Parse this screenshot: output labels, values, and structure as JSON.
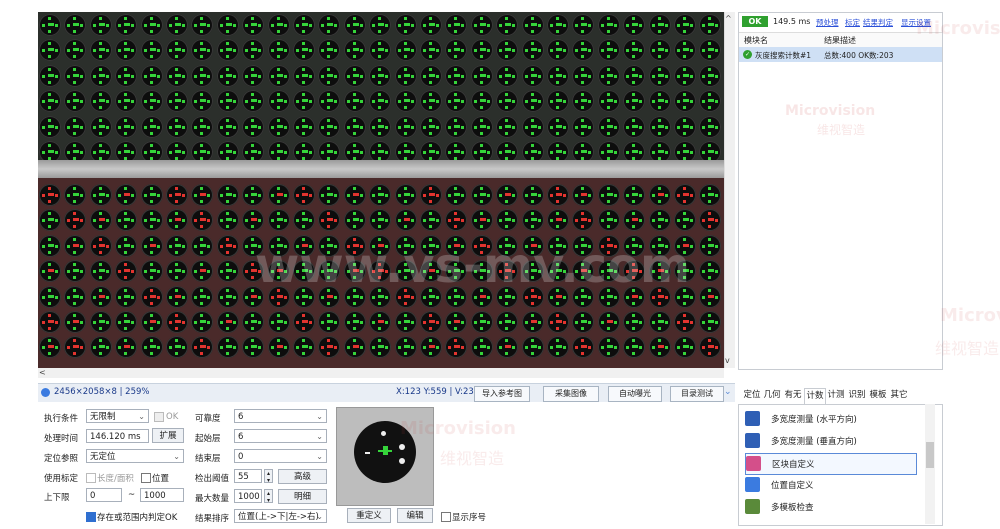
{
  "viewer": {
    "info": "2456×2058×8 | 259%",
    "coords": "X:123 Y:559 | V:23",
    "buttons": {
      "import_ref": "导入参考图",
      "capture": "采集图像",
      "auto_exposure": "自动曝光",
      "test": "目录测试"
    }
  },
  "params": {
    "exec_cond": {
      "label": "执行条件",
      "value": "无限制",
      "ok_label": "OK"
    },
    "proc_time": {
      "label": "处理时间",
      "value": "146.120 ms",
      "expand": "扩展"
    },
    "locate_ref": {
      "label": "定位参照",
      "value": "无定位"
    },
    "calib": {
      "label": "使用标定",
      "opt1": "长度/面积",
      "opt2": "位置"
    },
    "limits": {
      "label": "上下限",
      "low": "0",
      "tilde": "~",
      "high": "1000"
    },
    "in_range_ok": "存在或范围内判定OK",
    "tolerance": {
      "label": "可靠度",
      "value": "6"
    },
    "start_layer": {
      "label": "起始层",
      "value": "6"
    },
    "end_layer": {
      "label": "结束层",
      "value": "0"
    },
    "threshold": {
      "label": "检出阈值",
      "value": "55",
      "adv": "高级"
    },
    "max_count": {
      "label": "最大数量",
      "value": "1000",
      "detail": "明细"
    },
    "sort": {
      "label": "结果排序",
      "value": "位置(上->下|左->右)"
    },
    "redefine": "重定义",
    "edit": "编辑",
    "show_index": "显示序号"
  },
  "results": {
    "status": "OK",
    "time": "149.5 ms",
    "links": [
      "预处理",
      "标定",
      "结果判定",
      "显示设置"
    ],
    "col_name": "模块名",
    "col_desc": "结果描述",
    "rows": [
      {
        "name": "灰度搜索计数#1",
        "desc": "总数:400 OK数:203"
      }
    ]
  },
  "tabs": [
    "定位",
    "几何",
    "有无",
    "计数",
    "计测",
    "识别",
    "模板",
    "其它"
  ],
  "active_tab": "计数",
  "tools": [
    {
      "label": "多宽度测量 (水平方向)",
      "icon": "ruler-h-icon"
    },
    {
      "label": "多宽度测量 (垂直方向)",
      "icon": "ruler-v-icon"
    },
    {
      "label": "区块自定义",
      "icon": "grid-icon"
    },
    {
      "label": "位置自定义",
      "icon": "points-icon"
    },
    {
      "label": "多模板检查",
      "icon": "template-icon"
    }
  ],
  "watermarks": [
    "Microvision",
    "维视智造",
    "www.vs-mv.com"
  ],
  "colors": {
    "ok_green": "#2fa02f",
    "link_blue": "#2a4fd8",
    "dot_green": "#35d43a",
    "dot_red": "#e2342f"
  }
}
